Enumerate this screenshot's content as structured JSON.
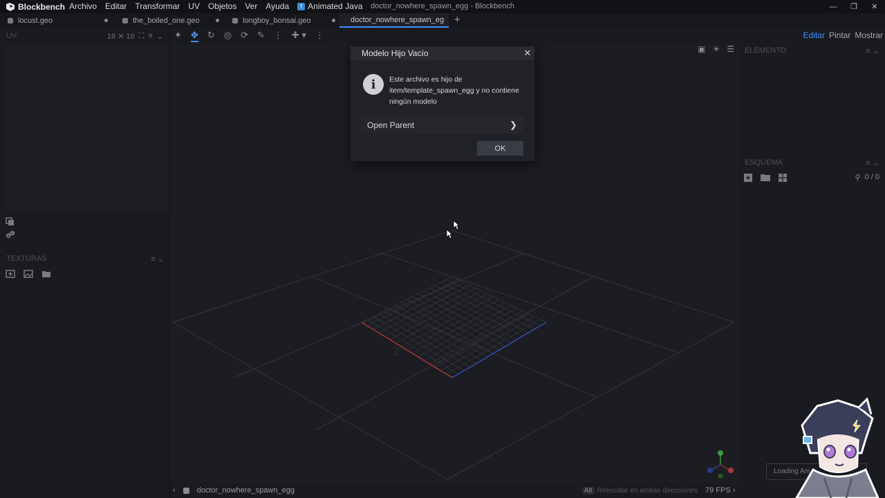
{
  "app": {
    "brand": "Blockbench",
    "window_title": "doctor_nowhere_spawn_egg - Blockbench"
  },
  "menu": {
    "items": [
      "Archivo",
      "Editar",
      "Transformar",
      "UV",
      "Objetos",
      "Ver",
      "Ayuda"
    ],
    "java": "Animated Java"
  },
  "tabs": [
    {
      "label": "locust.geo"
    },
    {
      "label": "the_boiled_one.geo"
    },
    {
      "label": "longboy_bonsai.geo"
    },
    {
      "label": "doctor_nowhere_spawn_eg"
    }
  ],
  "left": {
    "uv_title": "UV",
    "uv_size": "16 ✕ 16",
    "textures_title": "TEXTURAS"
  },
  "right": {
    "modes": {
      "edit": "Editar",
      "paint": "Pintar",
      "display": "Mostrar"
    },
    "element_title": "ELEMENTO",
    "outliner_title": "ESQUEMA",
    "outliner_count": "0 / 0"
  },
  "dialog": {
    "title": "Modelo Hijo Vacío",
    "message": "Este archivo es hijo de item/template_spawn_egg y no contiene ningún modelo",
    "open_parent": "Open Parent",
    "ok": "OK"
  },
  "status": {
    "model": "doctor_nowhere_spawn_egg",
    "alt_key": "Alt",
    "alt_hint": "Reescalar en ambas direcciones",
    "fps": "79 FPS",
    "loading": "Loading Ani"
  },
  "colors": {
    "accent": "#3e90ff",
    "background": "#1a1b20",
    "x_axis": "#c0383a",
    "z_axis": "#3556c9"
  }
}
